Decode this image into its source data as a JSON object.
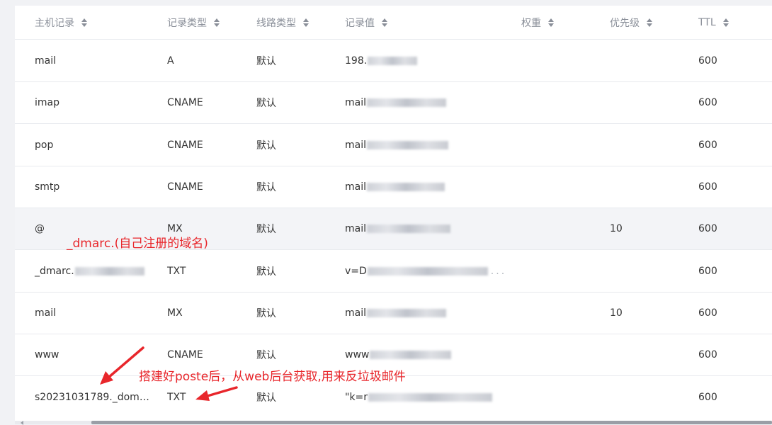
{
  "table": {
    "headers": {
      "host": "主机记录",
      "type": "记录类型",
      "line": "线路类型",
      "value": "记录值",
      "weight": "权重",
      "priority": "优先级",
      "ttl": "TTL"
    },
    "rows": [
      {
        "host": "mail",
        "type": "A",
        "line": "默认",
        "value": "198.",
        "weight": "",
        "priority": "",
        "ttl": "600"
      },
      {
        "host": "imap",
        "type": "CNAME",
        "line": "默认",
        "value": "mail",
        "weight": "",
        "priority": "",
        "ttl": "600"
      },
      {
        "host": "pop",
        "type": "CNAME",
        "line": "默认",
        "value": "mail",
        "weight": "",
        "priority": "",
        "ttl": "600"
      },
      {
        "host": "smtp",
        "type": "CNAME",
        "line": "默认",
        "value": "mail",
        "weight": "",
        "priority": "",
        "ttl": "600"
      },
      {
        "host": "@",
        "type": "MX",
        "line": "默认",
        "value": "mail",
        "weight": "",
        "priority": "10",
        "ttl": "600"
      },
      {
        "host": "_dmarc.",
        "type": "TXT",
        "line": "默认",
        "value": "v=D",
        "weight": "",
        "priority": "",
        "ttl": "600"
      },
      {
        "host": "mail",
        "type": "MX",
        "line": "默认",
        "value": "mail",
        "weight": "",
        "priority": "10",
        "ttl": "600"
      },
      {
        "host": "www",
        "type": "CNAME",
        "line": "默认",
        "value": "www",
        "weight": "",
        "priority": "",
        "ttl": "600"
      },
      {
        "host": "s20231031789._dom…",
        "type": "TXT",
        "line": "默认",
        "value": "\"k=r",
        "weight": "",
        "priority": "",
        "ttl": "600"
      }
    ]
  },
  "annotations": {
    "dmarc_note": "_dmarc.(自己注册的域名)",
    "poste_note": "搭建好poste后，从web后台获取,用来反垃圾邮件"
  },
  "colors": {
    "annotation": "#e8262b",
    "header_text": "#8a8f99",
    "highlight_row": "#f3f4f7"
  }
}
